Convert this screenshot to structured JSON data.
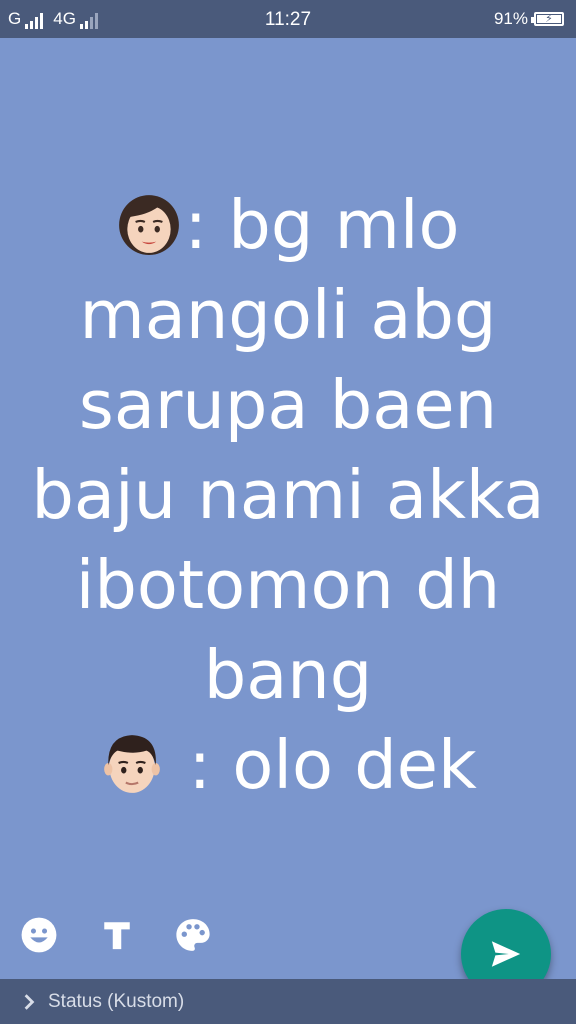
{
  "status_bar": {
    "carrier1": "G",
    "carrier2": "4G",
    "time": "11:27",
    "battery": "91%"
  },
  "status_text": {
    "lines": [
      ": bg mlo",
      "mangoli abg",
      "sarupa baen",
      "baju nami akka",
      "ibotomon dh",
      "bang",
      " : olo dek"
    ],
    "emoji_1": "woman-face-emoji",
    "emoji_2": "man-face-emoji"
  },
  "toolbar": {
    "emoji_icon": "smiley-icon",
    "text_icon_label": "T",
    "palette_icon": "palette-icon"
  },
  "send_button": {
    "icon": "send-icon"
  },
  "bottom_bar": {
    "label": "Status (Kustom)"
  },
  "colors": {
    "background": "#7b96cd",
    "status_bar": "#4a5a7b",
    "fab": "#0e9485",
    "text": "#ffffff"
  }
}
